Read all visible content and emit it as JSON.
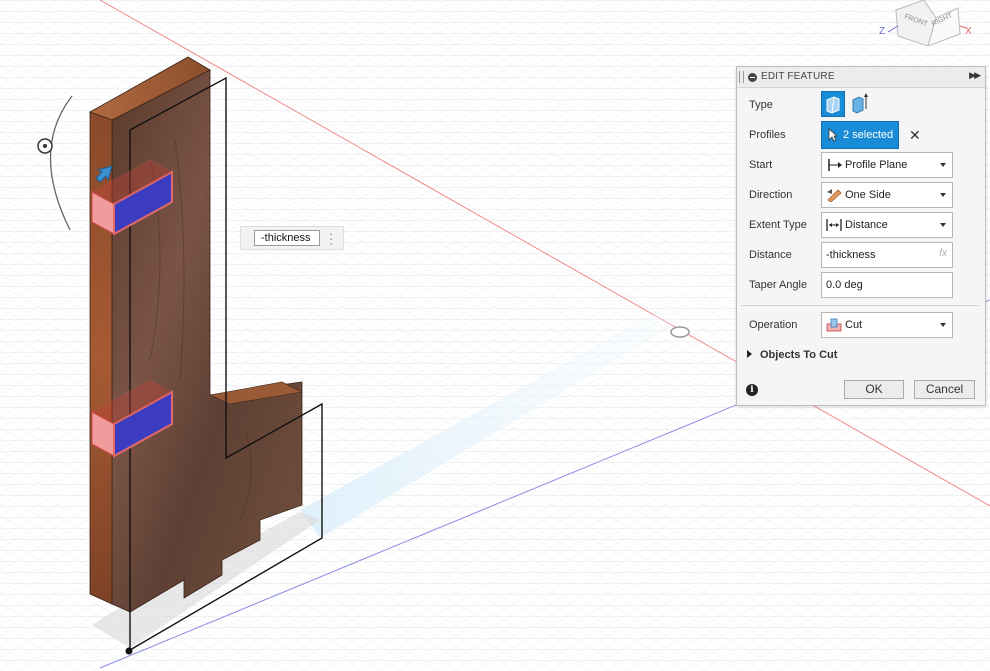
{
  "viewcube": {
    "front_label": "FRONT",
    "right_label": "RIGHT",
    "axis_z": "Z",
    "axis_x": "X"
  },
  "canvas": {
    "distance_value": "-thickness"
  },
  "panel": {
    "title": "EDIT FEATURE",
    "collapse_icon": "double-chevron-right-icon",
    "rows": {
      "type": {
        "label": "Type",
        "options": [
          "extrude-solid-icon",
          "extrude-surface-icon"
        ],
        "selected": 0
      },
      "profiles": {
        "label": "Profiles",
        "value": "2 selected"
      },
      "start": {
        "label": "Start",
        "value": "Profile Plane"
      },
      "direction": {
        "label": "Direction",
        "value": "One Side"
      },
      "extent_type": {
        "label": "Extent Type",
        "value": "Distance"
      },
      "distance": {
        "label": "Distance",
        "value": "-thickness",
        "fx": "fx"
      },
      "taper_angle": {
        "label": "Taper Angle",
        "value": "0.0 deg"
      },
      "operation": {
        "label": "Operation",
        "value": "Cut"
      }
    },
    "objects_to_cut": "Objects To Cut",
    "ok_label": "OK",
    "cancel_label": "Cancel"
  },
  "colors": {
    "accent": "#1a8bd6",
    "wood": "#6b4332",
    "cut_red": "#e84a4a",
    "cut_blue": "#3b3bbf"
  }
}
